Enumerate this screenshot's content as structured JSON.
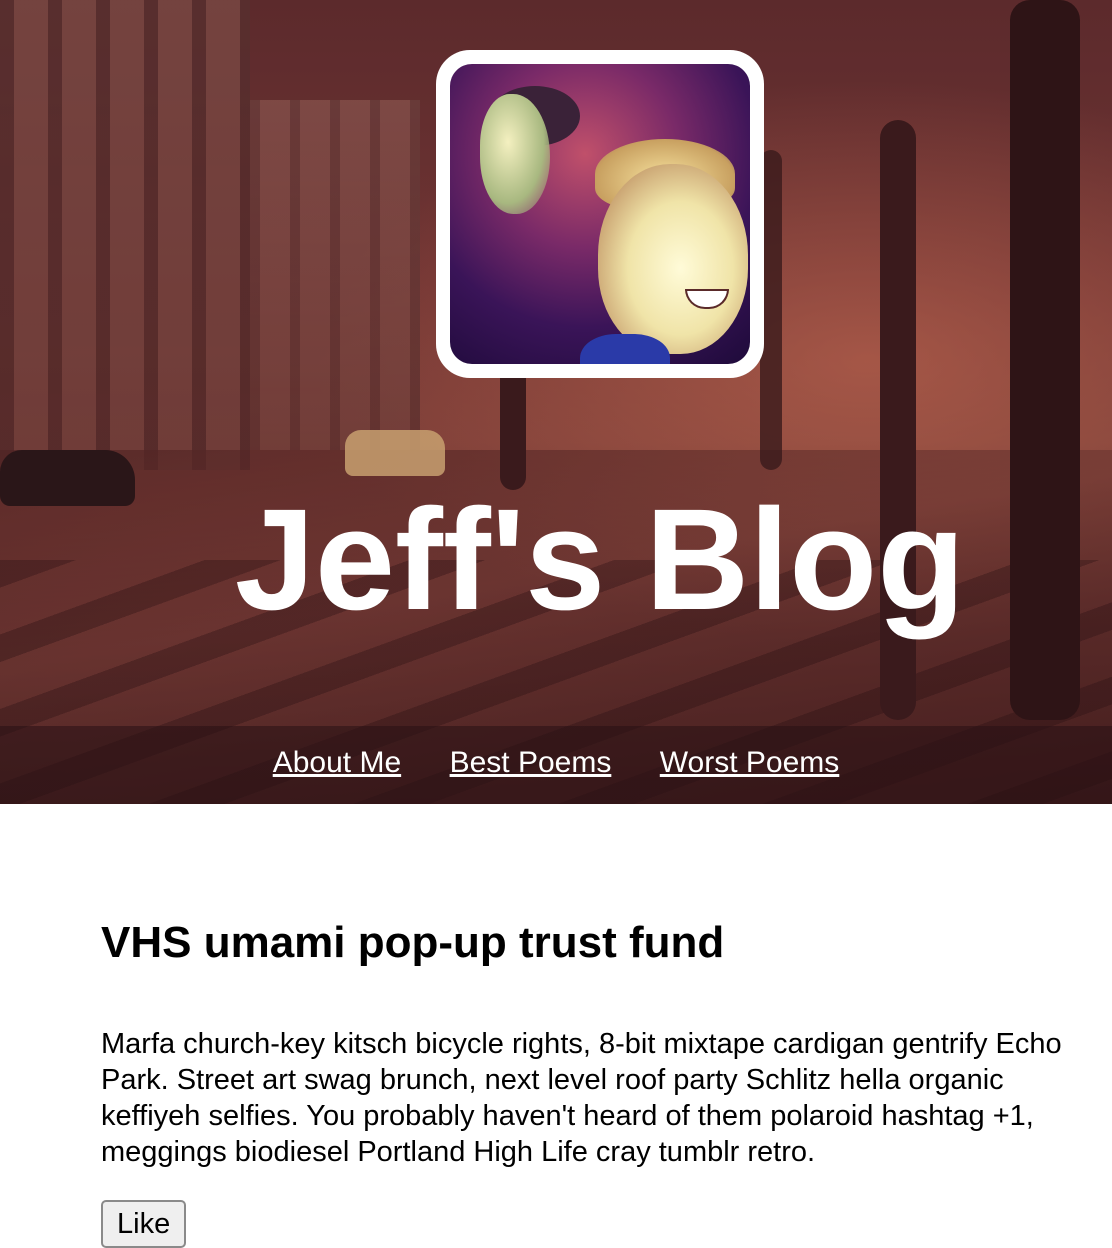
{
  "header": {
    "blog_title": "Jeff's Blog",
    "avatar_alt": "Jeff profile photo"
  },
  "nav": {
    "items": [
      {
        "label": "About Me"
      },
      {
        "label": "Best Poems"
      },
      {
        "label": "Worst Poems"
      }
    ]
  },
  "post": {
    "title": "VHS umami pop-up trust fund",
    "body": "Marfa church-key kitsch bicycle rights, 8-bit mixtape cardigan gentrify Echo Park. Street art swag brunch, next level roof party Schlitz hella organic keffiyeh selfies. You probably haven't heard of them polaroid hashtag +1, meggings biodiesel Portland High Life cray tumblr retro.",
    "like_label": "Like"
  }
}
